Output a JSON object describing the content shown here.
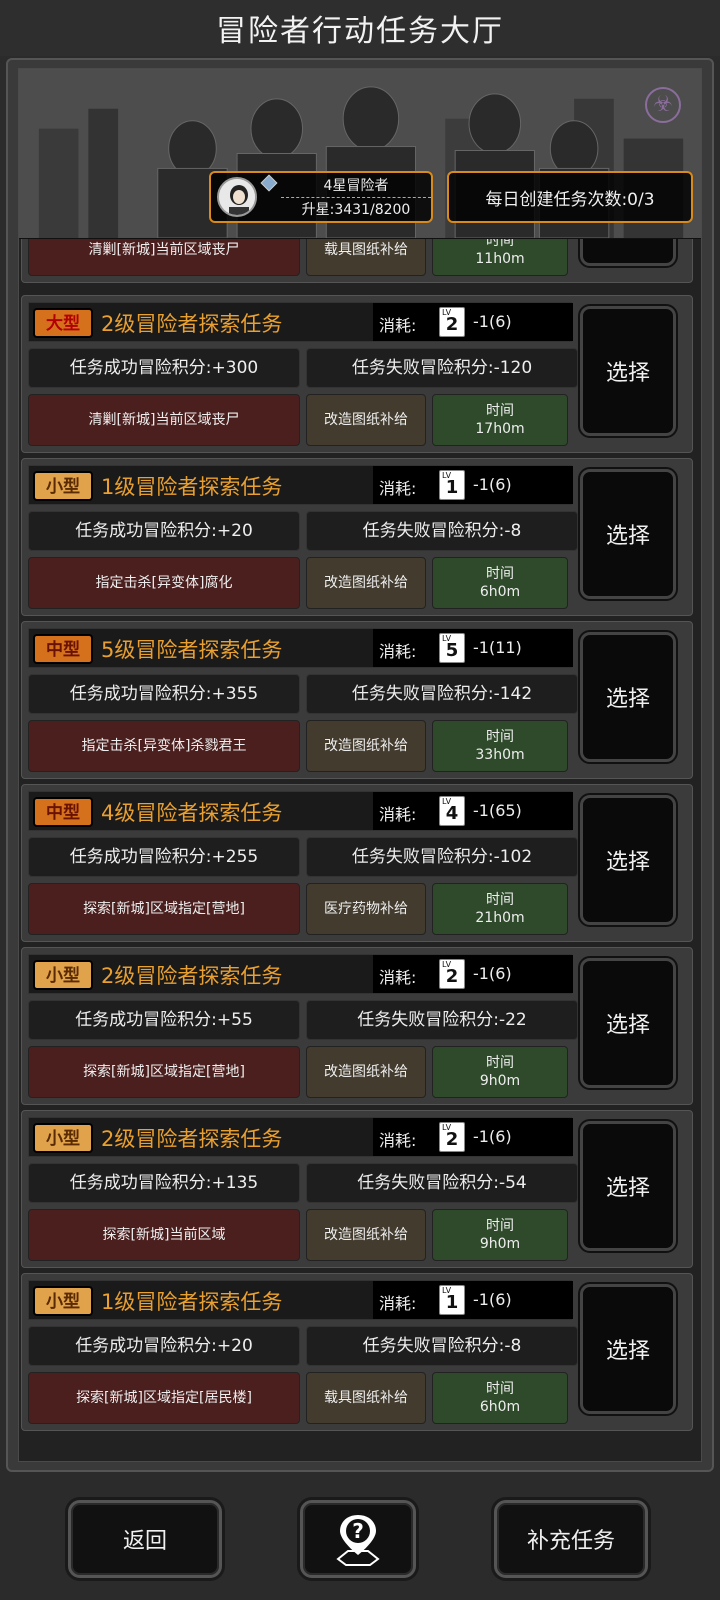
{
  "header": {
    "title": "冒险者行动任务大厅"
  },
  "profile": {
    "rank": "4星冒险者",
    "star_progress": "升星:3431/8200"
  },
  "daily": {
    "label": "每日创建任务次数:0/3"
  },
  "labels": {
    "cost": "消耗:",
    "time": "时间",
    "select": "选择"
  },
  "partial_task": {
    "target": "清剿[新城]当前区域丧尸",
    "reward": "载具图纸补给",
    "time": "11h0m"
  },
  "tasks": [
    {
      "size": "大型",
      "size_class": "large",
      "title": "2级冒险者探索任务",
      "level": "2",
      "cost": "-1(6)",
      "success": "任务成功冒险积分:+300",
      "fail": "任务失败冒险积分:-120",
      "target": "清剿[新城]当前区域丧尸",
      "reward": "改造图纸补给",
      "time": "17h0m"
    },
    {
      "size": "小型",
      "size_class": "small",
      "title": "1级冒险者探索任务",
      "level": "1",
      "cost": "-1(6)",
      "success": "任务成功冒险积分:+20",
      "fail": "任务失败冒险积分:-8",
      "target": "指定击杀[异变体]腐化",
      "reward": "改造图纸补给",
      "time": "6h0m"
    },
    {
      "size": "中型",
      "size_class": "mid",
      "title": "5级冒险者探索任务",
      "level": "5",
      "cost": "-1(11)",
      "success": "任务成功冒险积分:+355",
      "fail": "任务失败冒险积分:-142",
      "target": "指定击杀[异变体]杀戮君王",
      "reward": "改造图纸补给",
      "time": "33h0m"
    },
    {
      "size": "中型",
      "size_class": "mid",
      "title": "4级冒险者探索任务",
      "level": "4",
      "cost": "-1(65)",
      "success": "任务成功冒险积分:+255",
      "fail": "任务失败冒险积分:-102",
      "target": "探索[新城]区域指定[营地]",
      "reward": "医疗药物补给",
      "time": "21h0m"
    },
    {
      "size": "小型",
      "size_class": "small",
      "title": "2级冒险者探索任务",
      "level": "2",
      "cost": "-1(6)",
      "success": "任务成功冒险积分:+55",
      "fail": "任务失败冒险积分:-22",
      "target": "探索[新城]区域指定[营地]",
      "reward": "改造图纸补给",
      "time": "9h0m"
    },
    {
      "size": "小型",
      "size_class": "small",
      "title": "2级冒险者探索任务",
      "level": "2",
      "cost": "-1(6)",
      "success": "任务成功冒险积分:+135",
      "fail": "任务失败冒险积分:-54",
      "target": "探索[新城]当前区域",
      "reward": "改造图纸补给",
      "time": "9h0m"
    },
    {
      "size": "小型",
      "size_class": "small",
      "title": "1级冒险者探索任务",
      "level": "1",
      "cost": "-1(6)",
      "success": "任务成功冒险积分:+20",
      "fail": "任务失败冒险积分:-8",
      "target": "探索[新城]区域指定[居民楼]",
      "reward": "载具图纸补给",
      "time": "6h0m"
    }
  ],
  "bottom": {
    "back": "返回",
    "help_icon": "question-map-icon",
    "refill": "补充任务"
  },
  "colors": {
    "accent_orange": "#d88a1a",
    "title_orange": "#e9a030",
    "target_bg": "#4c1f1f",
    "reward_bg": "#423b2e",
    "time_bg": "#2e4a2a"
  }
}
